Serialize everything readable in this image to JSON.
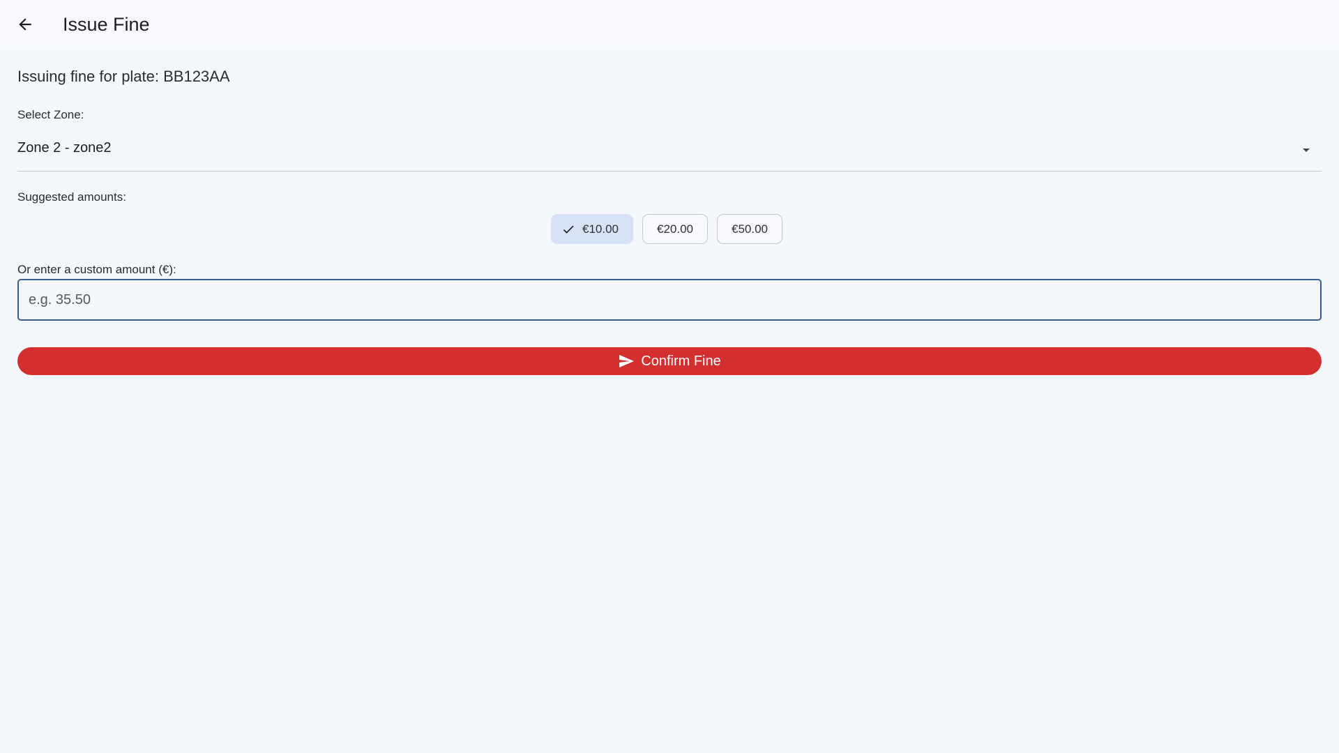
{
  "app_bar": {
    "title": "Issue Fine",
    "back_icon": "arrow-back-icon"
  },
  "form": {
    "plate_line": "Issuing fine for plate: BB123AA",
    "zone_label": "Select Zone:",
    "zone_selected": "Zone 2 - zone2",
    "dropdown_icon": "arrow-drop-down-icon",
    "suggested_label": "Suggested amounts:",
    "amounts": [
      {
        "label": "€10.00",
        "selected": true
      },
      {
        "label": "€20.00",
        "selected": false
      },
      {
        "label": "€50.00",
        "selected": false
      }
    ],
    "custom_label": "Or enter a custom amount (€):",
    "custom_value": "",
    "custom_placeholder": "e.g. 35.50",
    "confirm_label": "Confirm Fine",
    "confirm_icon": "send-icon"
  },
  "colors": {
    "background": "#f4f8fd",
    "confirm_button": "#d32f2f",
    "selected_chip": "#d6e3f7",
    "input_border_focus": "#3a5d8f"
  }
}
